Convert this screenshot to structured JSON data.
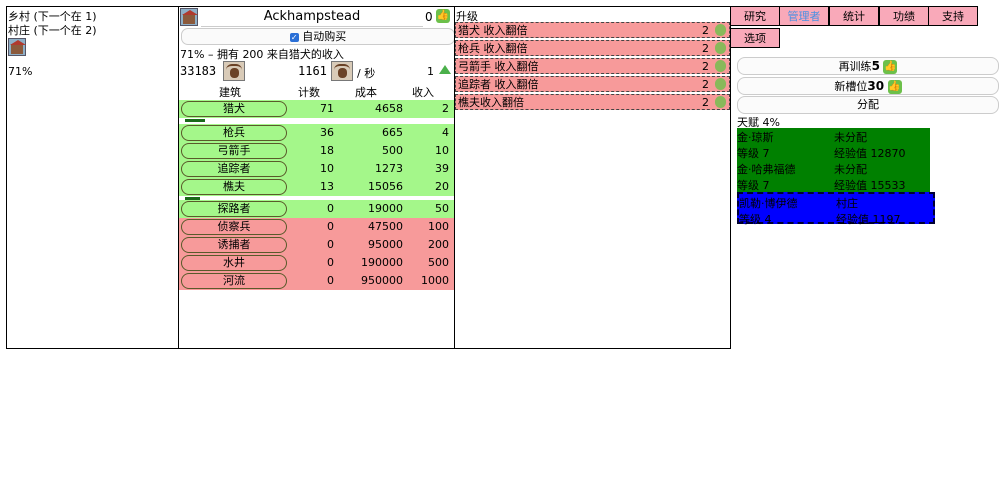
{
  "left": {
    "line1": "乡村 (下一个在 1)",
    "line2": "村庄 (下一个在 2)",
    "percent": "71%"
  },
  "village": {
    "name": "Ackhampstead",
    "count": "0",
    "autobuy": "自动购买",
    "info": "71% – 拥有 200 来自猎犬的收入",
    "money": "33183",
    "rate": "1161",
    "rate_unit": "/ 秒",
    "one": "1"
  },
  "table": {
    "headers": [
      "建筑",
      "计数",
      "成本",
      "收入"
    ],
    "rows": [
      {
        "name": "猎犬",
        "count": "71",
        "cost": "4658",
        "income": "2",
        "status": "green",
        "progress": 0.2
      },
      {
        "name": "枪兵",
        "count": "36",
        "cost": "665",
        "income": "4",
        "status": "green",
        "progress": null
      },
      {
        "name": "弓箭手",
        "count": "18",
        "cost": "500",
        "income": "10",
        "status": "green",
        "progress": null
      },
      {
        "name": "追踪者",
        "count": "10",
        "cost": "1273",
        "income": "39",
        "status": "green",
        "progress": null
      },
      {
        "name": "樵夫",
        "count": "13",
        "cost": "15056",
        "income": "20",
        "status": "green",
        "progress": 0.15
      },
      {
        "name": "探路者",
        "count": "0",
        "cost": "19000",
        "income": "50",
        "status": "green",
        "progress": null
      },
      {
        "name": "侦察兵",
        "count": "0",
        "cost": "47500",
        "income": "100",
        "status": "red",
        "progress": null
      },
      {
        "name": "诱捕者",
        "count": "0",
        "cost": "95000",
        "income": "200",
        "status": "red",
        "progress": null
      },
      {
        "name": "水井",
        "count": "0",
        "cost": "190000",
        "income": "500",
        "status": "red",
        "progress": null
      },
      {
        "name": "河流",
        "count": "0",
        "cost": "950000",
        "income": "1000",
        "status": "red",
        "progress": null
      }
    ]
  },
  "upgrades": {
    "title": "升级",
    "items": [
      {
        "label": "猎犬 收入翻倍",
        "n": "2"
      },
      {
        "label": "枪兵 收入翻倍",
        "n": "2"
      },
      {
        "label": "弓箭手 收入翻倍",
        "n": "2"
      },
      {
        "label": "追踪者 收入翻倍",
        "n": "2"
      },
      {
        "label": "樵夫收入翻倍",
        "n": "2"
      }
    ]
  },
  "tabs": [
    "研究",
    "管理者",
    "统计",
    "功绩",
    "支持",
    "选项"
  ],
  "manager": {
    "retrain": "再训练",
    "retrain_n": "5",
    "newslot": "新槽位",
    "newslot_n": "30",
    "assign": "分配",
    "talent": "天赋 4%",
    "cards": [
      {
        "name": "金·琼斯",
        "status": "未分配",
        "level": "等级 7",
        "xp": "经验值 12870",
        "color": "#008000"
      },
      {
        "name": "金·哈弗福德",
        "status": "未分配",
        "level": "等级 7",
        "xp": "经验值 15533",
        "color": "#008000"
      },
      {
        "name": "凯勒·博伊德",
        "status": "村庄",
        "level": "等级 4",
        "xp": "经验值 1197",
        "color": "#0000ff"
      }
    ]
  },
  "colors": {
    "green_row": "#a4f78a",
    "red_row": "#f79a9a",
    "tab": "#f9a9b9",
    "tab_active_text": "#4a90e2"
  }
}
